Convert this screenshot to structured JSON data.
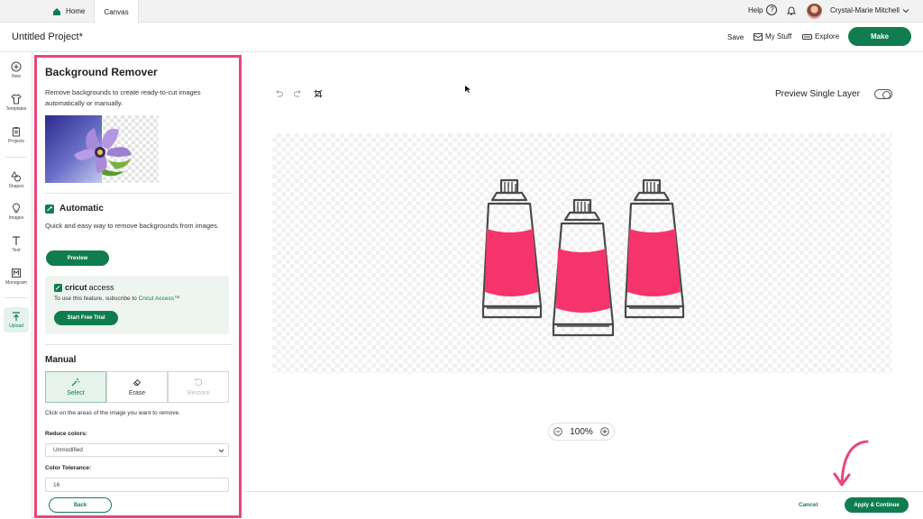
{
  "topbar": {
    "tab_home": "Home",
    "tab_canvas": "Canvas",
    "help_label": "Help",
    "help_glyph": "?",
    "username": "Crystal-Marie Mitchell"
  },
  "project": {
    "title": "Untitled Project*",
    "save": "Save",
    "my_stuff": "My Stuff",
    "explore": "Explore",
    "make": "Make"
  },
  "rail": {
    "items": [
      {
        "label": "New",
        "icon": "plus-circle-icon"
      },
      {
        "label": "Templates",
        "icon": "shirt-icon"
      },
      {
        "label": "Projects",
        "icon": "clipboard-icon"
      },
      {
        "label": "Shapes",
        "icon": "shapes-icon"
      },
      {
        "label": "Images",
        "icon": "lightbulb-icon"
      },
      {
        "label": "Text",
        "icon": "text-icon"
      },
      {
        "label": "Monogram",
        "icon": "monogram-icon"
      },
      {
        "label": "Upload",
        "icon": "upload-icon"
      }
    ]
  },
  "panel": {
    "title": "Background Remover",
    "description": "Remove backgrounds to create ready-to-cut images automatically or manually.",
    "automatic": {
      "heading": "Automatic",
      "description": "Quick and easy way to remove backgrounds from images.",
      "preview_button": "Preview"
    },
    "access": {
      "brand_cricut": "cricut",
      "brand_access": "access",
      "text_before": "To use this feature, subscribe to ",
      "link": "Cricut Access™",
      "trial_button": "Start Free Trial"
    },
    "manual": {
      "heading": "Manual",
      "tools": [
        {
          "label": "Select",
          "state": "selected"
        },
        {
          "label": "Erase",
          "state": "enabled"
        },
        {
          "label": "Restore",
          "state": "disabled"
        }
      ],
      "instruction": "Click on the areas of the image you want to remove.",
      "reduce_colors_label": "Reduce colors:",
      "reduce_colors_value": "Unmodified",
      "tolerance_label": "Color Tolerance:",
      "tolerance_value": "16"
    },
    "back_button": "Back"
  },
  "canvas": {
    "preview_single_layer": "Preview Single Layer",
    "zoom_level": "100%",
    "tube_fill_color": "#f5346b",
    "tube_stroke_color": "#4a4a4a"
  },
  "footer": {
    "cancel": "Cancel",
    "apply": "Apply & Continue"
  },
  "colors": {
    "accent_green": "#107d4f",
    "highlight_pink": "#e7467f"
  }
}
